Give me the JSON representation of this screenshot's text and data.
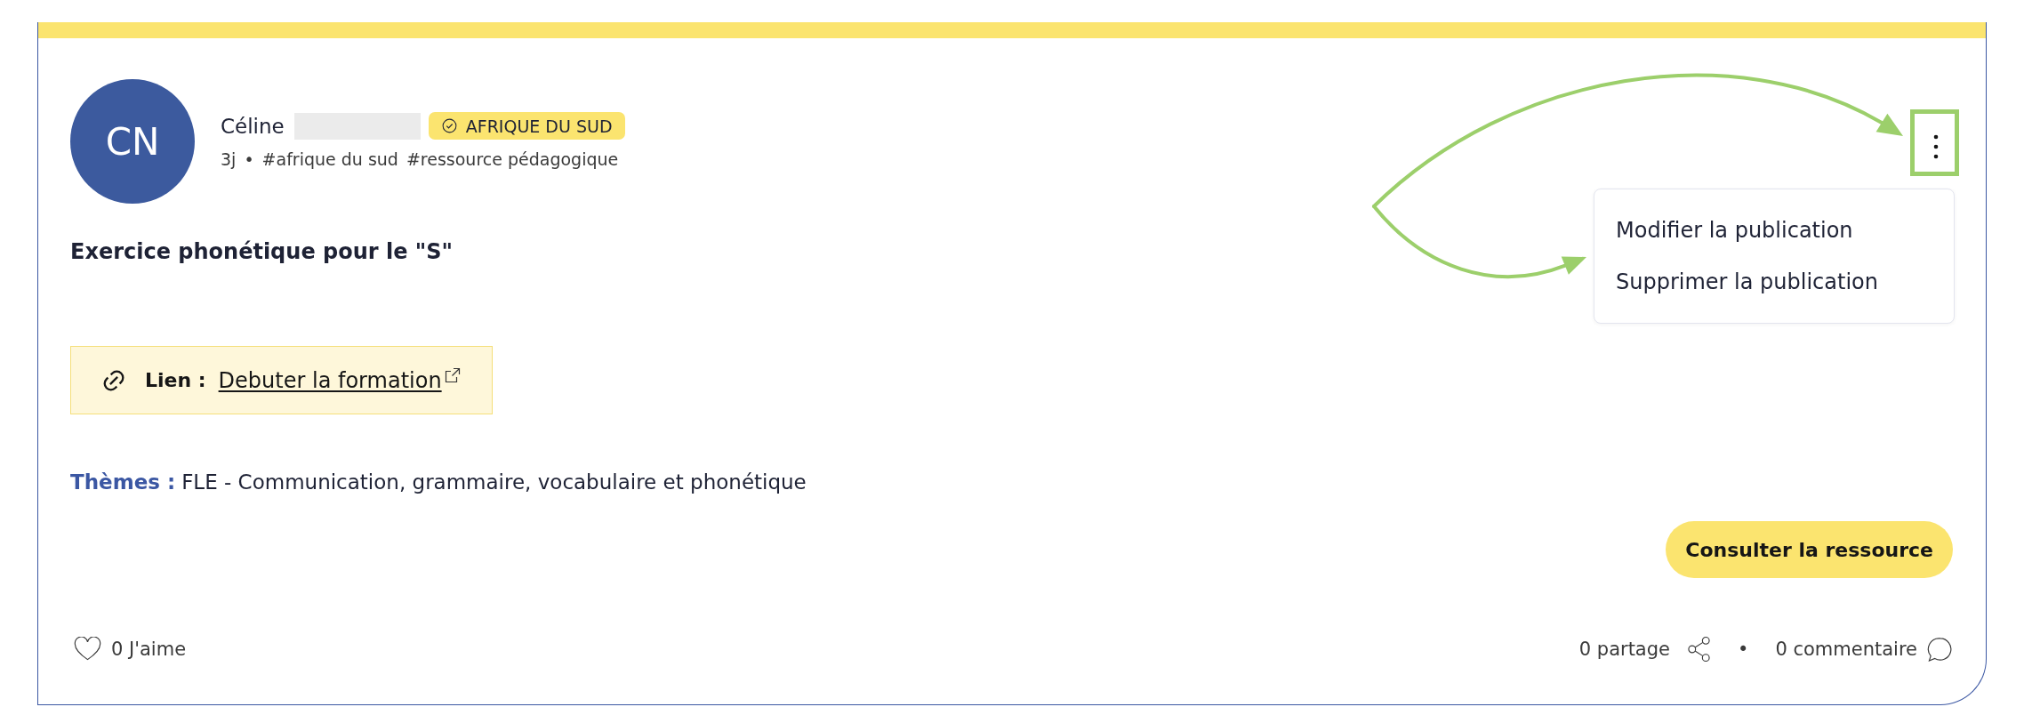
{
  "post": {
    "author": {
      "initials": "CN",
      "name": "Céline",
      "surname_redacted": true
    },
    "badge": {
      "label": "AFRIQUE DU SUD",
      "verified": true
    },
    "age": "3j",
    "separator": "•",
    "hashtags": [
      "#afrique du sud",
      "#ressource pédagogique"
    ],
    "menu_button": {
      "expanded": true
    },
    "menu": {
      "items": [
        {
          "label": "Modifier la publication"
        },
        {
          "label": "Supprimer la publication"
        }
      ]
    },
    "title": "Exercice phonétique pour le \"S\"",
    "link": {
      "label": "Lien :",
      "text": "Debuter la formation",
      "external": true
    },
    "themes": {
      "label": "Thèmes :",
      "value": "FLE - Communication, grammaire, vocabulaire et phonétique"
    },
    "action_button": "Consulter la ressource",
    "footer": {
      "likes": "0 J'aime",
      "shares": "0 partage",
      "separator": "•",
      "comments": "0 commentaire"
    }
  },
  "annotations": {
    "menu_button_frame": true,
    "arrow_to_menu_button": true,
    "arrow_to_menu": true
  }
}
